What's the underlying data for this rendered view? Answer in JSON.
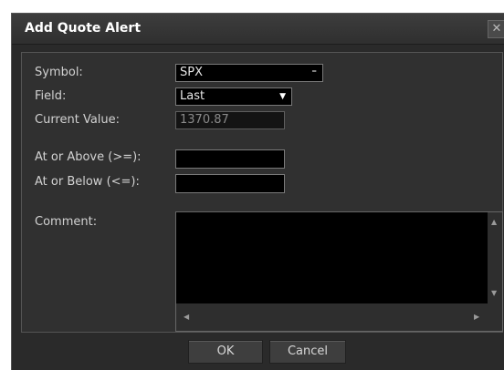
{
  "dialog": {
    "title": "Add Quote Alert",
    "close_glyph": "✕"
  },
  "form": {
    "symbol_label": "Symbol:",
    "symbol_value": "SPX",
    "field_label": "Field:",
    "field_value": "Last",
    "current_label": "Current Value:",
    "current_value": "1370.87",
    "above_label": "At or Above (>=):",
    "above_value": "",
    "below_label": "At or Below (<=):",
    "below_value": "",
    "comment_label": "Comment:",
    "comment_value": ""
  },
  "buttons": {
    "ok": "OK",
    "cancel": "Cancel"
  },
  "icons": {
    "dropdown": "triangle-down-icon",
    "scroll_up": "triangle-up-icon",
    "scroll_down": "triangle-down-icon",
    "scroll_left": "triangle-left-icon",
    "scroll_right": "triangle-right-icon"
  }
}
